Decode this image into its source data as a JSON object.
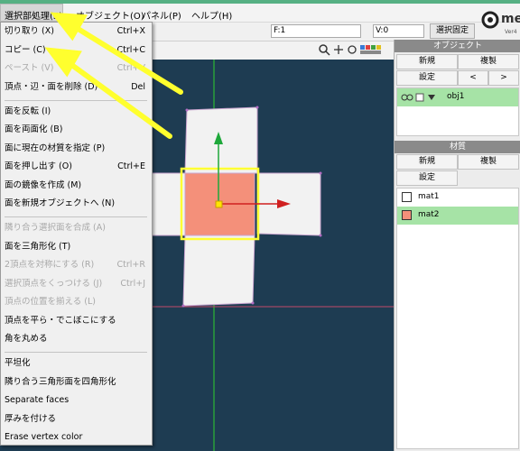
{
  "menubar": {
    "items": [
      "選択部処理(S)",
      "オブジェクト(O)",
      "パネル(P)",
      "ヘルプ(H)"
    ]
  },
  "toolbar": {
    "f_field": "F:1",
    "v_field": "V:0",
    "lock_selection": "選択固定"
  },
  "logo": {
    "text": "met",
    "sub": "Ver4"
  },
  "edit_menu": {
    "items": [
      {
        "label": "切り取り (X)",
        "shortcut": "Ctrl+X",
        "enabled": true
      },
      {
        "label": "コピー (C)",
        "shortcut": "Ctrl+C",
        "enabled": true
      },
      {
        "label": "ペースト (V)",
        "shortcut": "Ctrl+V",
        "enabled": false
      },
      {
        "label": "頂点・辺・面を削除 (D)",
        "shortcut": "Del",
        "enabled": true
      },
      {
        "label": "面を反転 (I)",
        "shortcut": "",
        "enabled": true
      },
      {
        "label": "面を両面化 (B)",
        "shortcut": "",
        "enabled": true
      },
      {
        "label": "面に現在の材質を指定 (P)",
        "shortcut": "",
        "enabled": true
      },
      {
        "label": "面を押し出す (O)",
        "shortcut": "Ctrl+E",
        "enabled": true
      },
      {
        "label": "面の鏡像を作成 (M)",
        "shortcut": "",
        "enabled": true
      },
      {
        "label": "面を新規オブジェクトへ (N)",
        "shortcut": "",
        "enabled": true
      },
      {
        "label": "隣り合う選択面を合成 (A)",
        "shortcut": "",
        "enabled": false
      },
      {
        "label": "面を三角形化 (T)",
        "shortcut": "",
        "enabled": true
      },
      {
        "label": "2頂点を対称にする (R)",
        "shortcut": "Ctrl+R",
        "enabled": false
      },
      {
        "label": "選択頂点をくっつける (J)",
        "shortcut": "Ctrl+J",
        "enabled": false
      },
      {
        "label": "頂点の位置を揃える (L)",
        "shortcut": "",
        "enabled": false
      },
      {
        "label": "頂点を平ら・でこぼこにする",
        "shortcut": "",
        "enabled": true
      },
      {
        "label": "角を丸める",
        "shortcut": "",
        "enabled": true
      },
      {
        "label": "平坦化",
        "shortcut": "",
        "enabled": true
      },
      {
        "label": "隣り合う三角形面を四角形化",
        "shortcut": "",
        "enabled": true
      },
      {
        "label": "Separate faces",
        "shortcut": "",
        "enabled": true
      },
      {
        "label": "厚みを付ける",
        "shortcut": "",
        "enabled": true
      },
      {
        "label": "Erase vertex color",
        "shortcut": "",
        "enabled": true
      }
    ]
  },
  "object_panel": {
    "title": "オブジェクト",
    "new_label": "新規",
    "duplicate_label": "複製",
    "settings_label": "設定",
    "prev_label": "<",
    "next_label": ">",
    "objects": [
      {
        "name": "obj1"
      }
    ]
  },
  "material_panel": {
    "title": "材質",
    "new_label": "新規",
    "duplicate_label": "複製",
    "settings_label": "設定",
    "materials": [
      {
        "name": "mat1",
        "color": "#ffffff",
        "selected": false
      },
      {
        "name": "mat2",
        "color": "#f4907a",
        "selected": true
      }
    ]
  },
  "colors": {
    "viewport_bg": "#1e3c52",
    "selection_highlight": "#ffff33",
    "selected_row": "#a6e3a6",
    "accent": "#56b083"
  }
}
